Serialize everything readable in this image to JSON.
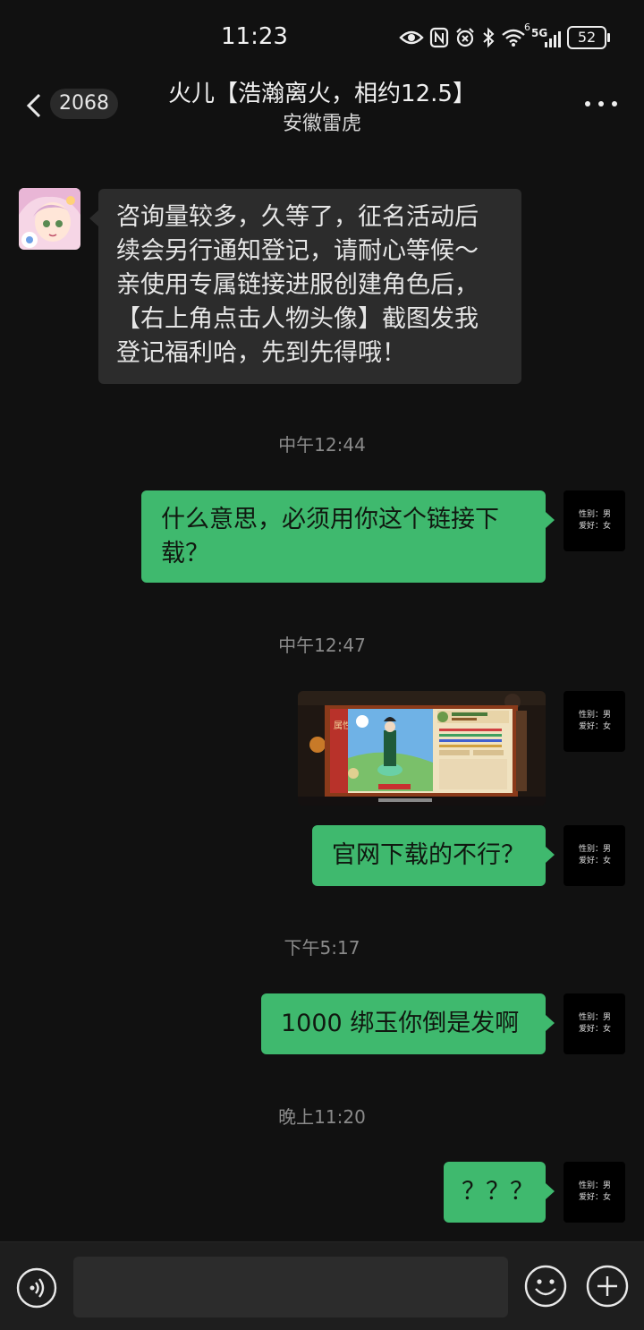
{
  "status_bar": {
    "time": "11:23",
    "network": "5G",
    "network_sup": "6",
    "battery": "52"
  },
  "header": {
    "back_count": "2068",
    "title": "火儿【浩瀚离火，相约12.5】",
    "subtitle": "安徽雷虎"
  },
  "messages": [
    {
      "direction": "in",
      "lines": [
        "咨询量较多，久等了，征名活动后",
        "续会另行通知登记，请耐心等候～",
        "亲使用专属链接进服创建角色后，",
        "【右上角点击人物头像】截图发我",
        "登记福利哈，先到先得哦！"
      ]
    },
    {
      "timestamp": "中午12:44"
    },
    {
      "direction": "out",
      "lines": [
        "什么意思，必须用你这个链接下",
        "载？"
      ]
    },
    {
      "timestamp": "中午12:47"
    },
    {
      "direction": "out",
      "type": "image",
      "caption": "属性"
    },
    {
      "direction": "out",
      "lines": [
        "官网下载的不行？"
      ]
    },
    {
      "timestamp": "下午5:17"
    },
    {
      "direction": "out",
      "lines": [
        "1000 绑玉你倒是发啊"
      ]
    },
    {
      "timestamp": "晚上11:20"
    },
    {
      "direction": "out",
      "lines": [
        "？？？"
      ]
    }
  ],
  "self_avatar": {
    "line1": "性别：男",
    "line2": "爱好：女"
  },
  "colors": {
    "background": "#111111",
    "incoming_bubble": "#2c2c2c",
    "outgoing_bubble": "#3fb96e"
  }
}
